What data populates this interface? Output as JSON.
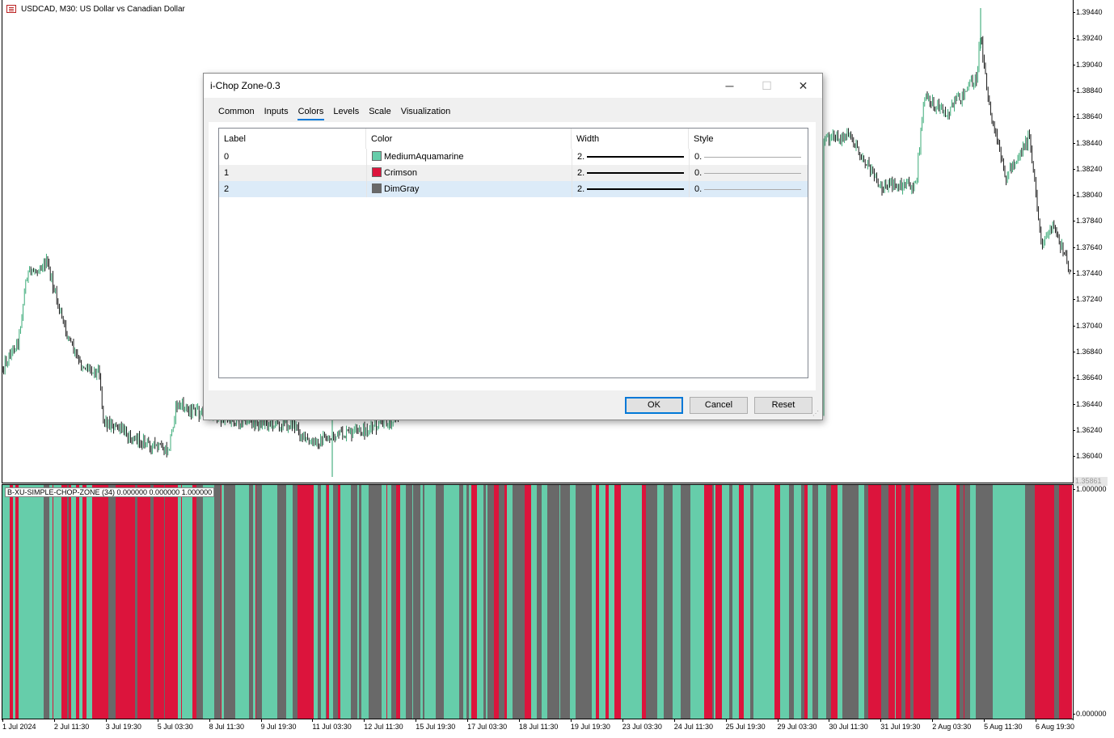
{
  "chart": {
    "title": "USDCAD, M30:  US Dollar vs Canadian Dollar",
    "price_labels": [
      "1.39440",
      "1.39240",
      "1.39040",
      "1.38840",
      "1.38640",
      "1.38440",
      "1.38240",
      "1.38040",
      "1.37840",
      "1.37640",
      "1.37440",
      "1.37240",
      "1.37040",
      "1.36840",
      "1.36640",
      "1.36440",
      "1.36240",
      "1.36040"
    ],
    "current_price": "1.35861",
    "time_labels": [
      "1 Jul 2024",
      "2 Jul 11:30",
      "3 Jul 19:30",
      "5 Jul 03:30",
      "8 Jul 11:30",
      "9 Jul 19:30",
      "11 Jul 03:30",
      "12 Jul 11:30",
      "15 Jul 19:30",
      "17 Jul 03:30",
      "18 Jul 11:30",
      "19 Jul 19:30",
      "23 Jul 03:30",
      "24 Jul 11:30",
      "25 Jul 19:30",
      "29 Jul 03:30",
      "30 Jul 11:30",
      "31 Jul 19:30",
      "2 Aug 03:30",
      "5 Aug 11:30",
      "6 Aug 19:30"
    ],
    "bull_color": "#26a269",
    "bar_color": "#000000"
  },
  "indicator": {
    "label": "B-XU-SIMPLE-CHOP-ZONE (34) 0.000000 0.000000 1.000000",
    "scale_top": "1.000000",
    "scale_bottom": "0.000000",
    "colors": {
      "0": "#66cdaa",
      "1": "#dc143c",
      "2": "#696969"
    }
  },
  "dialog": {
    "title": "i-Chop Zone-0.3",
    "tabs": [
      "Common",
      "Inputs",
      "Colors",
      "Levels",
      "Scale",
      "Visualization"
    ],
    "active_tab": "Colors",
    "columns": [
      "Label",
      "Color",
      "Width",
      "Style"
    ],
    "rows": [
      {
        "label": "0",
        "color_name": "MediumAquamarine",
        "color": "#66cdaa",
        "width": "2.",
        "style": "0."
      },
      {
        "label": "1",
        "color_name": "Crimson",
        "color": "#dc143c",
        "width": "2.",
        "style": "0."
      },
      {
        "label": "2",
        "color_name": "DimGray",
        "color": "#696969",
        "width": "2.",
        "style": "0."
      }
    ],
    "buttons": {
      "ok": "OK",
      "cancel": "Cancel",
      "reset": "Reset"
    },
    "window_controls": {
      "minimize": "─",
      "maximize": "☐",
      "close": "✕"
    }
  }
}
